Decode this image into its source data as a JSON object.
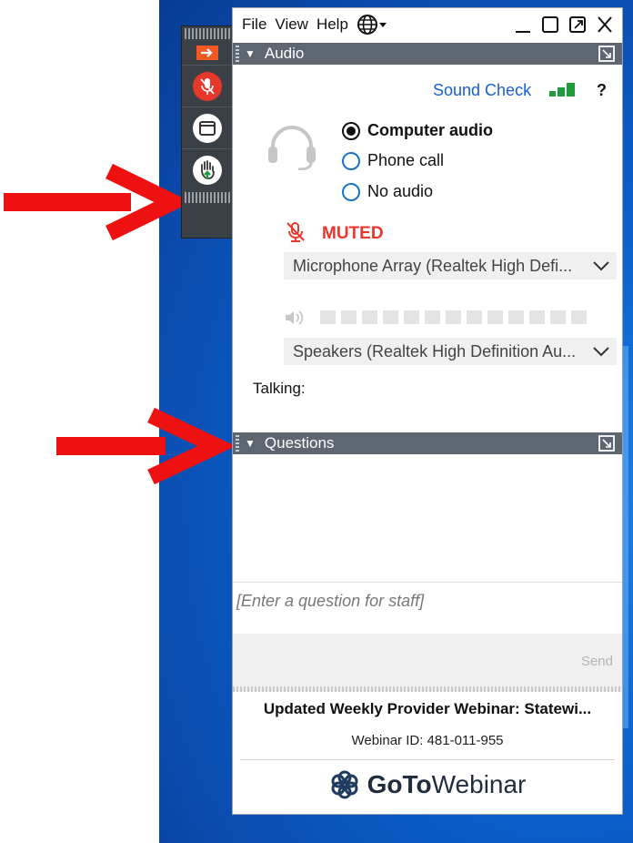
{
  "menu": {
    "file": "File",
    "view": "View",
    "help": "Help"
  },
  "audio": {
    "section_title": "Audio",
    "sound_check": "Sound Check",
    "help_mark": "?",
    "options": [
      "Computer audio",
      "Phone call",
      "No audio"
    ],
    "muted_label": "MUTED",
    "microphone": "Microphone Array (Realtek High Defi...",
    "speakers": "Speakers (Realtek High Definition Au...",
    "talking_label": "Talking:"
  },
  "questions": {
    "section_title": "Questions",
    "placeholder": "[Enter a question for staff]",
    "send_label": "Send"
  },
  "webinar": {
    "title": "Updated Weekly Provider Webinar: Statewi...",
    "id_line": "Webinar ID: 481-011-955",
    "brand_bold": "GoTo",
    "brand_light": "Webinar"
  },
  "colors": {
    "accent_blue": "#1a5fd6",
    "muted_red": "#e8372b",
    "signal_green": "#1e9b3a",
    "annotation_red": "#ee1111",
    "header_gray": "#5e6672"
  },
  "icons": [
    "exit-arrow-icon",
    "mic-muted-icon",
    "window-icon",
    "raise-hand-icon",
    "globe-icon",
    "headset-icon",
    "speaker-icon",
    "popout-icon",
    "chevron-down-icon"
  ]
}
